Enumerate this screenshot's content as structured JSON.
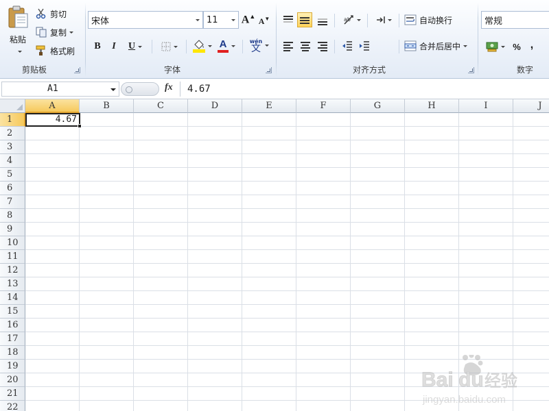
{
  "ribbon": {
    "clipboard": {
      "paste": "粘贴",
      "cut": "剪切",
      "copy": "复制",
      "format_painter": "格式刷",
      "group_label": "剪贴板"
    },
    "font": {
      "font_name": "宋体",
      "font_size": "11",
      "bold": "B",
      "italic": "I",
      "underline": "U",
      "font_color_letter": "A",
      "phonetic": "wén",
      "group_label": "字体"
    },
    "alignment": {
      "wrap_text": "自动换行",
      "merge_center": "合并后居中",
      "group_label": "对齐方式"
    },
    "number": {
      "format": "常规",
      "percent": "%",
      "comma": ",",
      "group_label": "数字"
    }
  },
  "formula_bar": {
    "name_box": "A1",
    "fx": "fx",
    "formula": "4.67"
  },
  "grid": {
    "columns": [
      "A",
      "B",
      "C",
      "D",
      "E",
      "F",
      "G",
      "H",
      "I",
      "J"
    ],
    "rows": [
      "1",
      "2",
      "3",
      "4",
      "5",
      "6",
      "7",
      "8",
      "9",
      "10",
      "11",
      "12",
      "13",
      "14",
      "15",
      "16",
      "17",
      "18",
      "19",
      "20",
      "21",
      "22"
    ],
    "selected_cell": "A1",
    "a1_value": "4.67"
  },
  "colors": {
    "highlight": "#ffd35a",
    "font_color": "#e02020",
    "fill_color": "#ffe600"
  }
}
